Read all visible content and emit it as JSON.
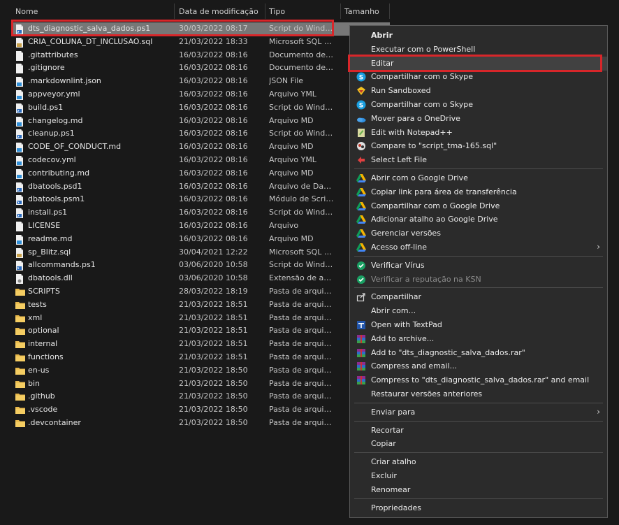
{
  "columns": {
    "name": "Nome",
    "date": "Data de modificação",
    "type": "Tipo",
    "size": "Tamanho"
  },
  "files": [
    {
      "name": "dts_diagnostic_salva_dados.ps1",
      "date": "30/03/2022 08:17",
      "type": "Script do Windows PowerShell",
      "icon": "powershell-file"
    },
    {
      "name": "CRIA_COLUNA_DT_INCLUSAO.sql",
      "date": "21/03/2022 18:33",
      "type": "Microsoft SQL Server Query File",
      "icon": "sql-file"
    },
    {
      "name": ".gitattributes",
      "date": "16/03/2022 08:16",
      "type": "Documento de Texto",
      "icon": "text-file"
    },
    {
      "name": ".gitignore",
      "date": "16/03/2022 08:16",
      "type": "Documento de Texto",
      "icon": "text-file"
    },
    {
      "name": ".markdownlint.json",
      "date": "16/03/2022 08:16",
      "type": "JSON File",
      "icon": "json-file"
    },
    {
      "name": "appveyor.yml",
      "date": "16/03/2022 08:16",
      "type": "Arquivo YML",
      "icon": "yml-file"
    },
    {
      "name": "build.ps1",
      "date": "16/03/2022 08:16",
      "type": "Script do Windows PowerShell",
      "icon": "powershell-file"
    },
    {
      "name": "changelog.md",
      "date": "16/03/2022 08:16",
      "type": "Arquivo MD",
      "icon": "md-file"
    },
    {
      "name": "cleanup.ps1",
      "date": "16/03/2022 08:16",
      "type": "Script do Windows PowerShell",
      "icon": "powershell-file"
    },
    {
      "name": "CODE_OF_CONDUCT.md",
      "date": "16/03/2022 08:16",
      "type": "Arquivo MD",
      "icon": "md-file"
    },
    {
      "name": "codecov.yml",
      "date": "16/03/2022 08:16",
      "type": "Arquivo YML",
      "icon": "yml-file"
    },
    {
      "name": "contributing.md",
      "date": "16/03/2022 08:16",
      "type": "Arquivo MD",
      "icon": "md-file"
    },
    {
      "name": "dbatools.psd1",
      "date": "16/03/2022 08:16",
      "type": "Arquivo de Dados do Windows PowerShell",
      "icon": "powershell-data-file"
    },
    {
      "name": "dbatools.psm1",
      "date": "16/03/2022 08:16",
      "type": "Módulo de Script do Windows PowerShell",
      "icon": "powershell-module-file"
    },
    {
      "name": "install.ps1",
      "date": "16/03/2022 08:16",
      "type": "Script do Windows PowerShell",
      "icon": "powershell-file"
    },
    {
      "name": "LICENSE",
      "date": "16/03/2022 08:16",
      "type": "Arquivo",
      "icon": "generic-file"
    },
    {
      "name": "readme.md",
      "date": "16/03/2022 08:16",
      "type": "Arquivo MD",
      "icon": "md-file"
    },
    {
      "name": "sp_Blitz.sql",
      "date": "30/04/2021 12:22",
      "type": "Microsoft SQL Server Query File",
      "icon": "sql-file"
    },
    {
      "name": "allcommands.ps1",
      "date": "03/06/2020 10:58",
      "type": "Script do Windows PowerShell",
      "icon": "powershell-file"
    },
    {
      "name": "dbatools.dll",
      "date": "03/06/2020 10:58",
      "type": "Extensão de aplicativo",
      "icon": "dll-file"
    },
    {
      "name": "SCRIPTS",
      "date": "28/03/2022 18:19",
      "type": "Pasta de arquivos",
      "icon": "folder"
    },
    {
      "name": "tests",
      "date": "21/03/2022 18:51",
      "type": "Pasta de arquivos",
      "icon": "folder"
    },
    {
      "name": "xml",
      "date": "21/03/2022 18:51",
      "type": "Pasta de arquivos",
      "icon": "folder"
    },
    {
      "name": "optional",
      "date": "21/03/2022 18:51",
      "type": "Pasta de arquivos",
      "icon": "folder"
    },
    {
      "name": "internal",
      "date": "21/03/2022 18:51",
      "type": "Pasta de arquivos",
      "icon": "folder"
    },
    {
      "name": "functions",
      "date": "21/03/2022 18:51",
      "type": "Pasta de arquivos",
      "icon": "folder"
    },
    {
      "name": "en-us",
      "date": "21/03/2022 18:50",
      "type": "Pasta de arquivos",
      "icon": "folder"
    },
    {
      "name": "bin",
      "date": "21/03/2022 18:50",
      "type": "Pasta de arquivos",
      "icon": "folder"
    },
    {
      "name": ".github",
      "date": "21/03/2022 18:50",
      "type": "Pasta de arquivos",
      "icon": "folder"
    },
    {
      "name": ".vscode",
      "date": "21/03/2022 18:50",
      "type": "Pasta de arquivos",
      "icon": "folder"
    },
    {
      "name": ".devcontainer",
      "date": "21/03/2022 18:50",
      "type": "Pasta de arquivos",
      "icon": "folder"
    }
  ],
  "context_menu": {
    "items": [
      {
        "label": "Abrir",
        "icon": "",
        "bold": true
      },
      {
        "label": "Executar com o PowerShell",
        "icon": ""
      },
      {
        "label": "Editar",
        "icon": "",
        "hover": true
      },
      {
        "label": "Compartilhar com o Skype",
        "icon": "skype-icon"
      },
      {
        "label": "Run Sandboxed",
        "icon": "sandboxie-icon"
      },
      {
        "label": "Compartilhar com o Skype",
        "icon": "skype-icon"
      },
      {
        "label": "Mover para o OneDrive",
        "icon": "onedrive-icon"
      },
      {
        "label": "Edit with Notepad++",
        "icon": "notepadpp-icon"
      },
      {
        "label": "Compare to \"script_tma-165.sql\"",
        "icon": "compare-icon"
      },
      {
        "label": "Select Left File",
        "icon": "select-left-icon"
      },
      {
        "sep": true
      },
      {
        "label": "Abrir com o Google Drive",
        "icon": "google-drive-icon"
      },
      {
        "label": "Copiar link para área de transferência",
        "icon": "google-drive-icon"
      },
      {
        "label": "Compartilhar com o Google Drive",
        "icon": "google-drive-icon"
      },
      {
        "label": "Adicionar atalho ao Google Drive",
        "icon": "google-drive-icon"
      },
      {
        "label": "Gerenciar versões",
        "icon": "google-drive-icon"
      },
      {
        "label": "Acesso off-line",
        "icon": "google-drive-icon",
        "submenu": true
      },
      {
        "sep": true
      },
      {
        "label": "Verificar Vírus",
        "icon": "kaspersky-icon"
      },
      {
        "label": "Verificar a reputação na KSN",
        "icon": "kaspersky-icon",
        "disabled": true
      },
      {
        "sep": true
      },
      {
        "label": "Compartilhar",
        "icon": "share-icon"
      },
      {
        "label": "Abrir com...",
        "icon": ""
      },
      {
        "label": "Open with TextPad",
        "icon": "textpad-icon"
      },
      {
        "label": "Add to archive...",
        "icon": "winrar-icon"
      },
      {
        "label": "Add to \"dts_diagnostic_salva_dados.rar\"",
        "icon": "winrar-icon"
      },
      {
        "label": "Compress and email...",
        "icon": "winrar-icon"
      },
      {
        "label": "Compress to \"dts_diagnostic_salva_dados.rar\" and email",
        "icon": "winrar-icon"
      },
      {
        "label": "Restaurar versões anteriores",
        "icon": ""
      },
      {
        "sep": true
      },
      {
        "label": "Enviar para",
        "icon": "",
        "submenu": true
      },
      {
        "sep": true
      },
      {
        "label": "Recortar",
        "icon": ""
      },
      {
        "label": "Copiar",
        "icon": ""
      },
      {
        "sep": true
      },
      {
        "label": "Criar atalho",
        "icon": ""
      },
      {
        "label": "Excluir",
        "icon": ""
      },
      {
        "label": "Renomear",
        "icon": ""
      },
      {
        "sep": true
      },
      {
        "label": "Propriedades",
        "icon": ""
      }
    ]
  },
  "submenu_arrow": "›",
  "colors": {
    "background": "#191919",
    "menu": "#2b2b2b",
    "selection": "#777777",
    "highlight_border": "#d8262a"
  }
}
